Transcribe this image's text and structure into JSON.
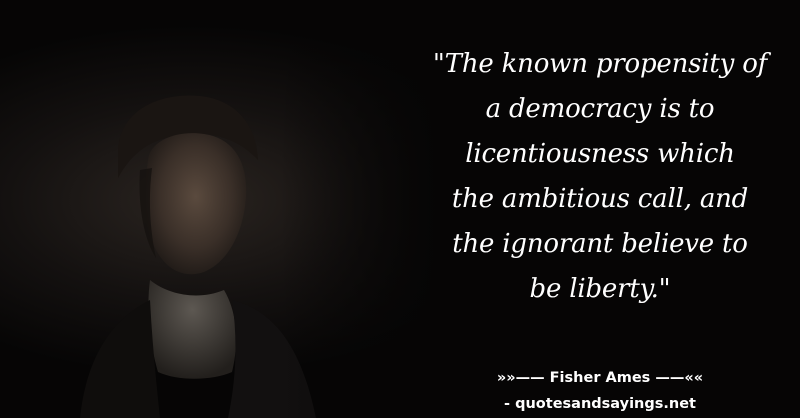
{
  "quote": {
    "lines": [
      "\"The known propensity of",
      "a democracy is to",
      "licentiousness which",
      "the ambitious call, and",
      "the ignorant believe to",
      "be liberty.\""
    ]
  },
  "attribution": {
    "text": "»»—— Fisher Ames ——««"
  },
  "source": {
    "text": "- quotesandsayings.net"
  },
  "colors": {
    "background": "#060505",
    "text": "#ffffff"
  }
}
